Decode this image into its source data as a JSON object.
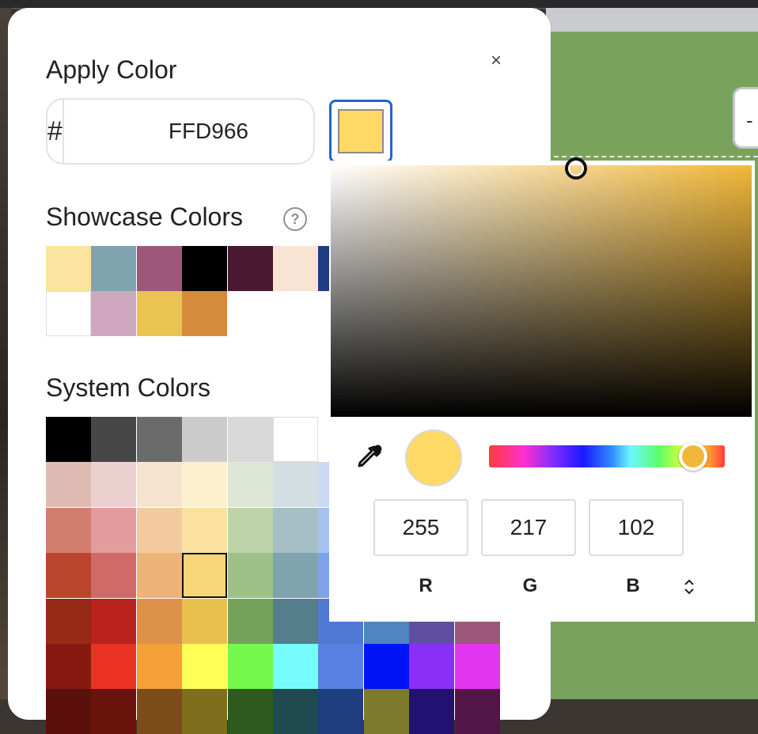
{
  "dialog": {
    "title": "Apply Color",
    "close_label": "×",
    "hex_prefix": "#",
    "hex_value": "FFD966",
    "current_color": "#FFD966"
  },
  "showcase": {
    "title": "Showcase Colors",
    "help_label": "?",
    "colors": [
      "#FAE4A0",
      "#7FA3AF",
      "#9B5878",
      "#000000",
      "#4A1830",
      "#F9E4D4",
      "#1F3D80",
      "#FFFFFF",
      "#CFA8C0",
      "#EAC353",
      "#D68A3C"
    ]
  },
  "system": {
    "title": "System Colors",
    "rows": [
      [
        "#000000",
        "#474747",
        "#6B6B6B",
        "#CCCCCC",
        "#D9D9D9",
        "#FFFFFF"
      ],
      [
        "#E0BBB3",
        "#ECCFCF",
        "#F7E4D0",
        "#FDF0CF",
        "#DEE7D6",
        "#D2DEE1",
        "#CCD9F4"
      ],
      [
        "#D27E6F",
        "#E39C9C",
        "#F3CAA0",
        "#FAE19E",
        "#BDD3A9",
        "#A6BFC5",
        "#A6C3F0"
      ],
      [
        "#B9452D",
        "#D06A68",
        "#EDB478",
        "#F7D677",
        "#9EC187",
        "#7FA3AF",
        "#7FA3EA"
      ],
      [
        "#962A17",
        "#BA231D",
        "#DE914A",
        "#E9C04E",
        "#77A259",
        "#557E8C",
        "#4F79D3",
        "#4F86C1",
        "#5E4FA0",
        "#9B5878"
      ],
      [
        "#871911",
        "#EB3323",
        "#F4A139",
        "#FFFF56",
        "#75F94C",
        "#78FBFC",
        "#5782E3",
        "#0013F7",
        "#8B2FF6",
        "#E135F0"
      ],
      [
        "#5C100B",
        "#6A130D",
        "#7E4B1A",
        "#7F6E1C",
        "#2F5A1E",
        "#1F4A50",
        "#1E3E80",
        "#7C7A2B",
        "#211271",
        "#531548"
      ]
    ],
    "selected": "#F7D677"
  },
  "picker": {
    "saturation_brightness_color": "#F0B73A",
    "preview_color": "#FFD966",
    "hue_color": "#F0B73A",
    "rgb": {
      "r": "255",
      "g": "217",
      "b": "102"
    },
    "labels": {
      "r": "R",
      "g": "G",
      "b": "B"
    },
    "mode_toggle": "⌃⌄"
  }
}
